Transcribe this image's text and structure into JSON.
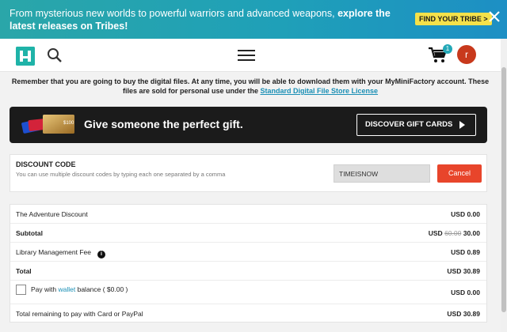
{
  "promo": {
    "text_normal": "From mysterious new worlds to powerful warriors and advanced weapons, ",
    "text_bold": "explore the latest releases on Tribes!",
    "button_label": "FIND YOUR TRIBE >",
    "close_icon": "close-icon"
  },
  "header": {
    "logo_icon": "logo-icon",
    "search_icon": "search-icon",
    "menu_icon": "hamburger-menu-icon",
    "cart_icon": "cart-icon",
    "cart_count": "1",
    "avatar_initial": "r"
  },
  "notice": {
    "text": "Remember that you are going to buy the digital files. At any time, you will be able to download them with your MyMiniFactory account. These files are sold for personal use under the ",
    "link": "Standard Digital File Store License"
  },
  "gift": {
    "card_value": "$100",
    "text": "Give someone the perfect gift.",
    "button_label": "DISCOVER GIFT CARDS"
  },
  "discount": {
    "title": "DISCOUNT CODE",
    "subtitle": "You can use multiple discount codes by typing each one separated by a comma",
    "input_value": "TIMEISNOW",
    "cancel_label": "Cancel"
  },
  "summary": {
    "rows": [
      {
        "label": "The Adventure Discount",
        "value": "USD 0.00"
      },
      {
        "label": "Subtotal",
        "currency": "USD",
        "old_value": "60.00",
        "value": "30.00"
      },
      {
        "label": "Library Management Fee",
        "value": "USD 0.89"
      },
      {
        "label": "Total",
        "value": "USD 30.89"
      },
      {
        "label_pre": "Pay with ",
        "label_link": "wallet",
        "label_post": " balance ( $0.00 )",
        "value": "USD 0.00"
      },
      {
        "label": "Total remaining to pay with Card or PayPal",
        "value": "USD 30.89"
      }
    ]
  },
  "colors": {
    "promo_gradient_start": "#2aa6a9",
    "promo_gradient_end": "#1d8fc4",
    "tribe_button": "#f5e14a",
    "brand_teal": "#1fb3a8",
    "cancel_red": "#e8452b",
    "avatar": "#c8391c",
    "link_blue": "#1a8fb5"
  }
}
